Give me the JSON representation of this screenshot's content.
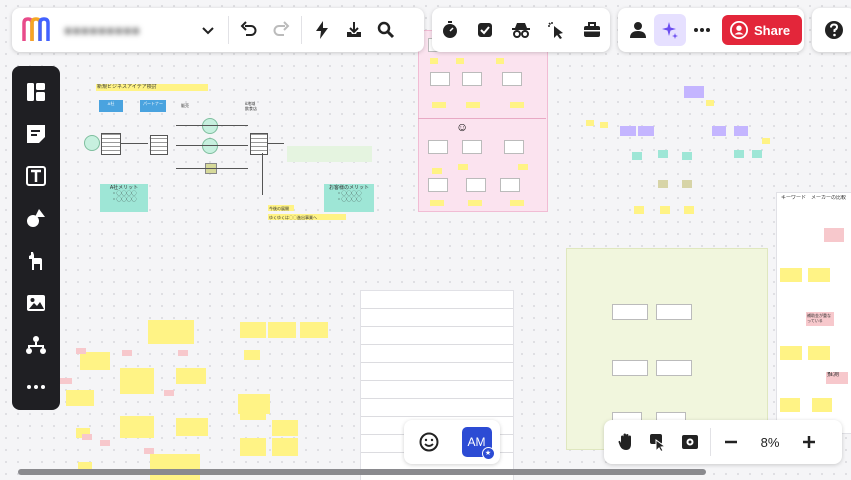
{
  "board": {
    "title_obscured": "●●●●●●●●●"
  },
  "canvas_text": {
    "header_note": "新規ビジネスアイデア検討",
    "box_a": "A社",
    "box_partner": "パートナー",
    "label_sales": "販売",
    "label_region": "6地域\n飲食店",
    "a_merit": "A社メリット\n・◯◯◯◯\n・◯◯◯◯",
    "customer_merit": "お客様のメリット\n・◯◯◯◯\n・◯◯◯◯",
    "problem_title": "今後の展開",
    "problem_text": "ゆくゆくは◯◯進出事業へ",
    "keyword_heading": "キーワード　メーカーの比較",
    "tag_subsidy": "補助金が重なっている",
    "tag_recommend": "推測"
  },
  "zoom": {
    "level": "8%"
  },
  "share": {
    "label": "Share"
  },
  "avatar": {
    "initials": "AM"
  },
  "colors": {
    "accent": "#e3263a",
    "sticky_yellow": "#fff385",
    "sticky_pink": "#f7c8cc",
    "teal_card": "#9ee6d6",
    "pink_frame": "#fbe3ef",
    "sidebar_dark": "#1f1f23"
  }
}
